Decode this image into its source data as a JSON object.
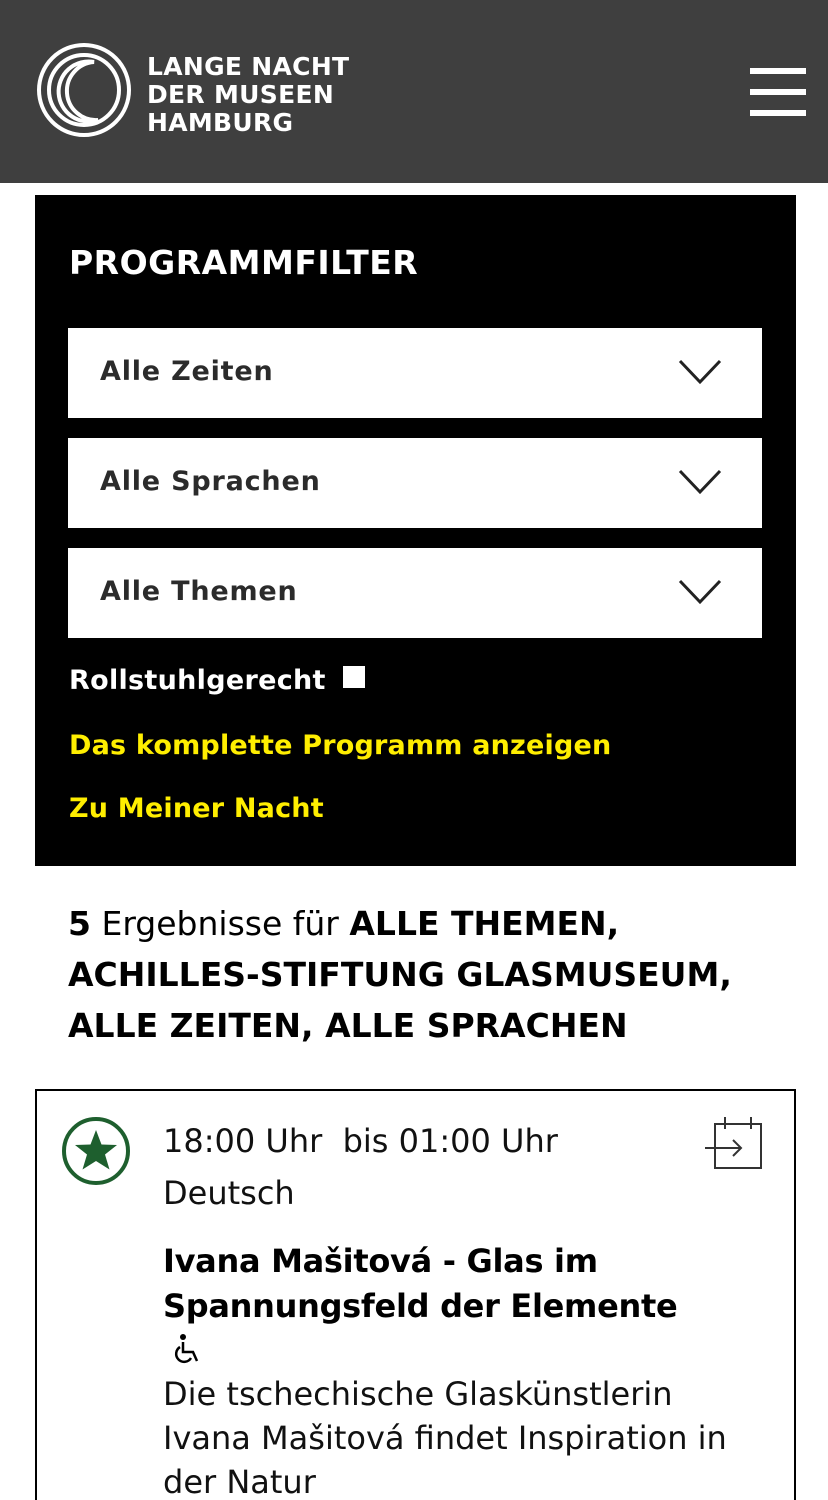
{
  "header": {
    "logo_lines": [
      "LANGE NACHT",
      "DER MUSEEN",
      "HAMBURG"
    ]
  },
  "filter": {
    "title": "PROGRAMMFILTER",
    "selects": [
      {
        "label": "Alle Zeiten"
      },
      {
        "label": "Alle Sprachen"
      },
      {
        "label": "Alle Themen"
      }
    ],
    "wheelchair_label": "Rollstuhlgerecht",
    "wheelchair_checked": false,
    "link_full_program": "Das komplette Programm anzeigen",
    "link_my_night": "Zu Meiner Nacht"
  },
  "results": {
    "count": "5",
    "text_for": "Ergebnisse für",
    "filters": "ALLE THEMEN, ACHILLES-STIFTUNG GLASMUSEUM, ALLE ZEITEN, ALLE SPRACHEN"
  },
  "event": {
    "time": "18:00 Uhr  bis 01:00 Uhr",
    "language": "Deutsch",
    "title": "Ivana Mašitová - Glas im Spannungsfeld der Elemente",
    "description": "Die tschechische Glaskünstlerin Ivana Mašitová findet Inspiration in der Natur"
  },
  "colors": {
    "header_bg": "#3f3f3f",
    "filter_bg": "#000000",
    "link_yellow": "#ffee00",
    "favorite_green": "#1e5f2e"
  }
}
